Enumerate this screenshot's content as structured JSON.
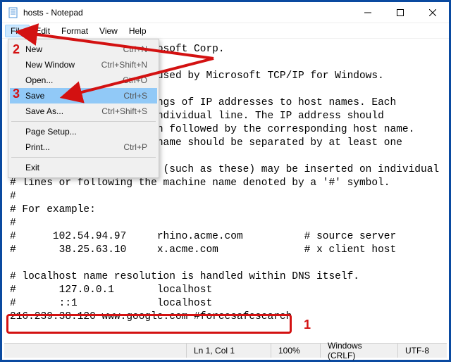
{
  "window": {
    "title": "hosts - Notepad"
  },
  "menubar": {
    "file": "File",
    "edit": "Edit",
    "format": "Format",
    "view": "View",
    "help": "Help"
  },
  "file_menu": {
    "new": {
      "label": "New",
      "shortcut": "Ctrl+N"
    },
    "new_window": {
      "label": "New Window",
      "shortcut": "Ctrl+Shift+N"
    },
    "open": {
      "label": "Open...",
      "shortcut": "Ctrl+O"
    },
    "save": {
      "label": "Save",
      "shortcut": "Ctrl+S"
    },
    "save_as": {
      "label": "Save As...",
      "shortcut": "Ctrl+Shift+S"
    },
    "page_setup": {
      "label": "Page Setup...",
      "shortcut": ""
    },
    "print": {
      "label": "Print...",
      "shortcut": "Ctrl+P"
    },
    "exit": {
      "label": "Exit",
      "shortcut": ""
    }
  },
  "editor": {
    "l1": "                    Microsoft Corp.",
    "l2": "#",
    "l3": "                    ile used by Microsoft TCP/IP for Windows.",
    "l4": "#",
    "l5": "                    appings of IP addresses to host names. Each",
    "l6": "                    an individual line. The IP address should",
    "l7": "                    olumn followed by the corresponding host name.",
    "l8": "                    ost name should be separated by at least one",
    "l9": "#",
    "l10": "# Additionally, comments (such as these) may be inserted on individual",
    "l11": "# lines or following the machine name denoted by a '#' symbol.",
    "l12": "#",
    "l13": "# For example:",
    "l14": "#",
    "l15": "#      102.54.94.97     rhino.acme.com          # source server",
    "l16": "#       38.25.63.10     x.acme.com              # x client host",
    "l17": "",
    "l18": "# localhost name resolution is handled within DNS itself.",
    "l19": "#       127.0.0.1       localhost",
    "l20": "#       ::1             localhost",
    "l21": "216.239.38.120 www.google.com #forcesafesearch"
  },
  "status": {
    "pos": "Ln 1, Col 1",
    "zoom": "100%",
    "eol": "Windows (CRLF)",
    "encoding": "UTF-8"
  },
  "annotations": {
    "n1": "1",
    "n2": "2",
    "n3": "3"
  }
}
